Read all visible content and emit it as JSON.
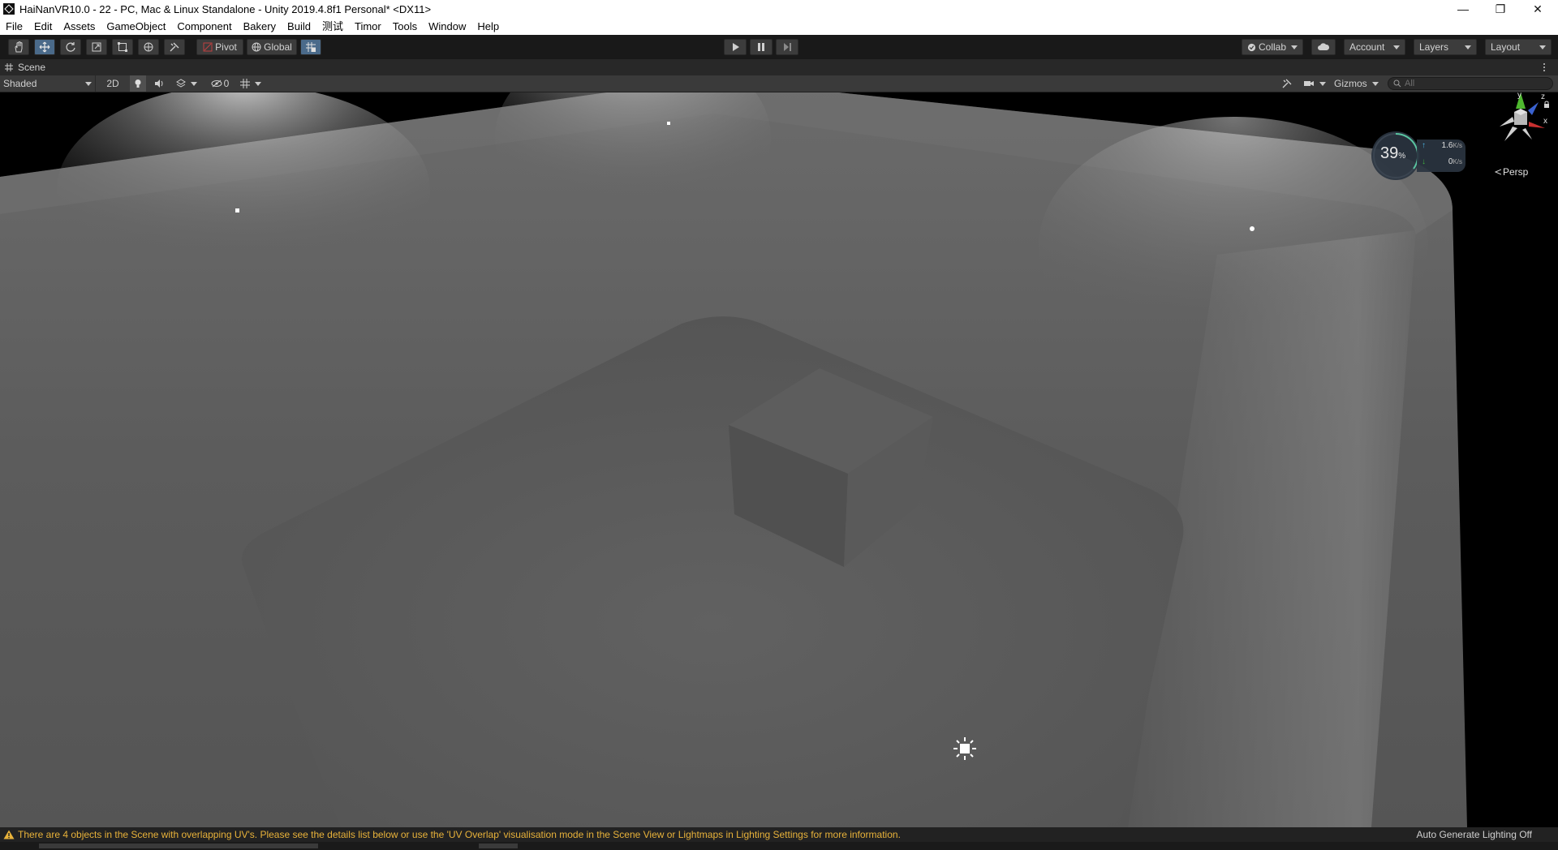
{
  "window": {
    "title": "HaiNanVR10.0 - 22 - PC, Mac & Linux Standalone - Unity 2019.4.8f1 Personal* <DX11>",
    "minimize_glyph": "—",
    "restore_glyph": "❐",
    "close_glyph": "✕"
  },
  "menu": [
    "File",
    "Edit",
    "Assets",
    "GameObject",
    "Component",
    "Bakery",
    "Build",
    "测试",
    "Timor",
    "Tools",
    "Window",
    "Help"
  ],
  "toolbar": {
    "pivot_label": "Pivot",
    "global_label": "Global",
    "collab_label": "Collab",
    "account_label": "Account",
    "layers_label": "Layers",
    "layout_label": "Layout"
  },
  "scene_tab": {
    "label": "Scene"
  },
  "scene_bar": {
    "shading_mode": "Shaded",
    "mode_2d": "2D",
    "hidden_count": "0",
    "gizmos_label": "Gizmos",
    "search_placeholder": "All"
  },
  "viewport": {
    "projection_label": "Persp",
    "axis_y": "y",
    "axis_z": "z",
    "axis_x": "x"
  },
  "net_monitor": {
    "percent": "39",
    "percent_unit": "%",
    "upload": "1.6",
    "upload_unit": "K/s",
    "download": "0",
    "download_unit": "K/s"
  },
  "status": {
    "warning": "There are 4 objects in the Scene with overlapping UV's. Please see the details list below or use the 'UV Overlap' visualisation mode in the Scene View or Lightmaps in Lighting Settings for more information.",
    "lighting": "Auto Generate Lighting Off"
  },
  "colors": {
    "toolbar_bg": "#191919",
    "status_warning": "#e8b23a",
    "active_tool": "#4a6a8a"
  }
}
